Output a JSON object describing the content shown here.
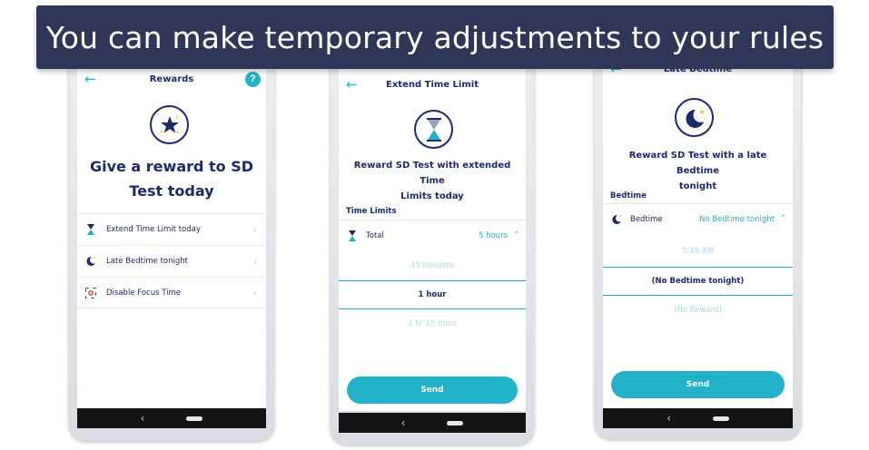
{
  "banner": {
    "text": "You can make temporary adjustments to your rules"
  },
  "colors": {
    "accent": "#22b2c9",
    "navy": "#1d2a6b",
    "banner": "#2f3657"
  },
  "phone1": {
    "header_title": "Rewards",
    "help_label": "?",
    "heading_line1": "Give a reward to SD",
    "heading_line2": "Test today",
    "items": [
      {
        "label": "Extend Time Limit today",
        "icon": "hourglass-icon"
      },
      {
        "label": "Late Bedtime tonight",
        "icon": "moon-icon"
      },
      {
        "label": "Disable Focus Time",
        "icon": "focus-icon"
      }
    ]
  },
  "phone2": {
    "header_title": "Extend Time Limit",
    "heading_line1": "Reward SD Test with extended Time",
    "heading_line2": "Limits today",
    "section_label": "Time Limits",
    "setting_label": "Total",
    "setting_value": "5 hours",
    "options": [
      "45 minutes",
      "1 hour",
      "1 hr 15 mins"
    ],
    "send_label": "Send"
  },
  "phone3": {
    "header_title": "Late Bedtime",
    "heading_line1": "Reward SD Test with a late Bedtime",
    "heading_line2": "tonight",
    "section_label": "Bedtime",
    "setting_label": "Bedtime",
    "setting_value": "No Bedtime tonight",
    "options": [
      "5:45 AM",
      "(No Bedtime tonight)",
      "(No Reward)"
    ],
    "send_label": "Send"
  },
  "nav": {
    "back_glyph": "‹"
  }
}
